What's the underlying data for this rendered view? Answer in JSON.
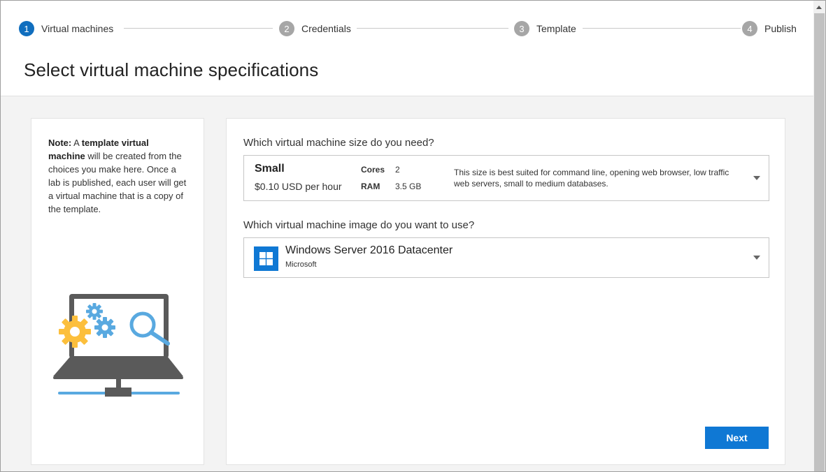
{
  "stepper": {
    "steps": [
      {
        "number": "1",
        "label": "Virtual machines",
        "state": "active"
      },
      {
        "number": "2",
        "label": "Credentials",
        "state": "inactive"
      },
      {
        "number": "3",
        "label": "Template",
        "state": "inactive"
      },
      {
        "number": "4",
        "label": "Publish",
        "state": "inactive"
      }
    ]
  },
  "page": {
    "title": "Select virtual machine specifications"
  },
  "note": {
    "bold_prefix": "Note:",
    "text_1": " A ",
    "bold_term": "template virtual machine",
    "text_2": " will be created from the choices you make here. Once a lab is published, each user will get a virtual machine that is a copy of the template."
  },
  "size_section": {
    "question": "Which virtual machine size do you need?",
    "selected": {
      "name": "Small",
      "price": "$0.10 USD per hour",
      "cores_label": "Cores",
      "cores_value": "2",
      "ram_label": "RAM",
      "ram_value": "3.5 GB",
      "description": "This size is best suited for command line, opening web browser, low traffic web servers, small to medium databases."
    }
  },
  "image_section": {
    "question": "Which virtual machine image do you want to use?",
    "selected": {
      "name": "Windows Server 2016 Datacenter",
      "publisher": "Microsoft",
      "icon": "windows-logo-icon"
    }
  },
  "actions": {
    "next_label": "Next"
  },
  "colors": {
    "accent": "#0f78d4",
    "step_active": "#106ebe",
    "step_inactive": "#a6a6a6",
    "gear_yellow": "#fcbf3c",
    "gear_blue": "#59a9e0",
    "laptop_dark": "#5a5a5a"
  }
}
